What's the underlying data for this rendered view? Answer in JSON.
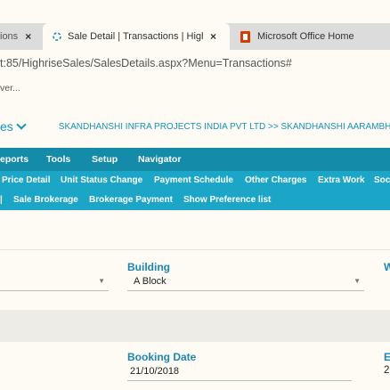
{
  "browser": {
    "tabs": [
      {
        "label": "ions"
      },
      {
        "label": "Sale Detail | Transactions | Highri"
      },
      {
        "label": "Microsoft Office Home"
      }
    ],
    "close_glyph": "×",
    "url": "t:85/HighriseSales/SalesDetails.aspx?Menu=Transactions#",
    "find_text": "ver..."
  },
  "header": {
    "module": "es",
    "breadcrumb": "SKANDHANSHI INFRA PROJECTS INDIA PVT LTD >> SKANDHANSHI AARAMBH"
  },
  "menu": {
    "items": [
      "eports",
      "Tools",
      "Setup",
      "Navigator"
    ]
  },
  "submenu": {
    "row1": [
      "Price Detail",
      "Unit Status Change",
      "Payment Schedule",
      "Other Charges",
      "Extra Work",
      "Soc"
    ],
    "row2": [
      "Sale Brokerage",
      "Brokerage Payment",
      "Show Preference list"
    ]
  },
  "form": {
    "building_label": "Building",
    "building_value": "A Block",
    "next_label": "W",
    "booking_date_label": "Booking Date",
    "booking_date_value": "21/10/2018",
    "next2_label": "E",
    "next2_value": "2"
  },
  "colors": {
    "accent": "#1693b8",
    "menu_bg": "#148ba9",
    "submenu_bg": "#1ba6c8"
  }
}
